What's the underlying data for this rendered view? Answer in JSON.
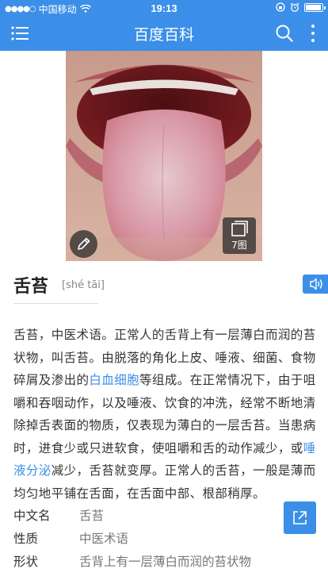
{
  "status_bar": {
    "carrier": "中国移动",
    "time": "19:13",
    "battery_level": 0.95
  },
  "nav": {
    "title": "百度百科"
  },
  "hero": {
    "photo_count": "7图"
  },
  "entry": {
    "title": "舌苔",
    "pinyin": "[shé tāi]"
  },
  "summary": {
    "p1": "舌苔，中医术语。正常人的舌背上有一层薄白而润的苔状物，叫舌苔。由脱落的角化上皮、唾液、细菌、食物碎屑及渗出的",
    "link1": "白血细胞",
    "p2": "等组成。在正常情况下，由于咀嚼和吞咽动作，以及唾液、饮食的冲洗，经常不断地清除掉舌表面的物质，仅表现为薄白的一层舌苔。当患病时，进食少或只进软食，使咀嚼和舌的动作减少，或",
    "link2": "唾液分泌",
    "p3": "减少，舌苔就变厚。正常人的舌苔，一般是薄而均匀地平铺在舌面，在舌面中部、根部稍厚。"
  },
  "basic_info": [
    {
      "key": "中文名",
      "value": "舌苔"
    },
    {
      "key": "性质",
      "value": "中医术语"
    },
    {
      "key": "形状",
      "value": "舌背上有一层薄白而润的苔状物"
    }
  ],
  "colors": {
    "brand": "#3b8fe8",
    "link": "#3b8fe8"
  }
}
